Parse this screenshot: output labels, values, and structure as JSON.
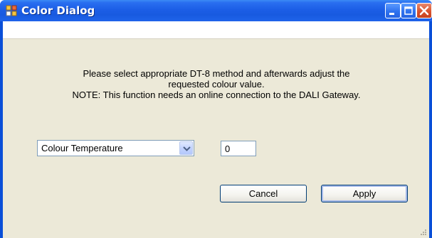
{
  "window": {
    "title": "Color Dialog"
  },
  "message": {
    "line1": "Please select appropriate DT-8 method and afterwards adjust the",
    "line2": "requested colour value.",
    "line3": "NOTE: This function needs an online connection to the DALI Gateway."
  },
  "method_select": {
    "selected": "Colour Temperature"
  },
  "value_input": {
    "value": "0"
  },
  "buttons": {
    "cancel": "Cancel",
    "apply": "Apply"
  },
  "icons": {
    "app": "app-window-icon",
    "minimize": "minimize-icon",
    "maximize": "maximize-icon",
    "close": "close-icon",
    "dropdown": "chevron-down-icon"
  }
}
